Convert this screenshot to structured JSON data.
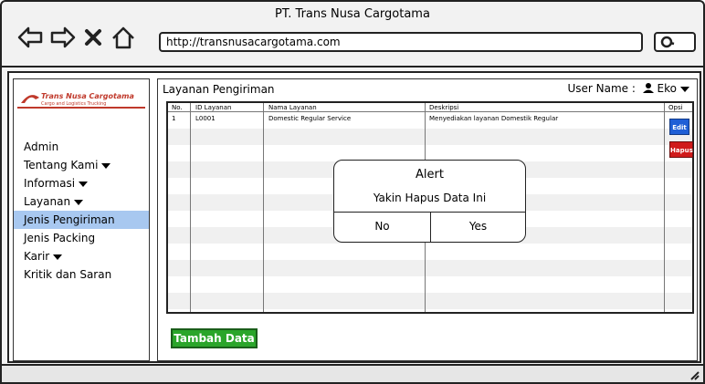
{
  "window": {
    "title": "PT. Trans Nusa Cargotama",
    "url": "http://transnusacargotama.com"
  },
  "sidebar": {
    "logo_text": "Trans Nusa Cargotama",
    "logo_sub": "Cargo and Logistics Trucking",
    "items": [
      {
        "label": "Admin",
        "has_caret": false
      },
      {
        "label": "Tentang Kami",
        "has_caret": true
      },
      {
        "label": "Informasi",
        "has_caret": true
      },
      {
        "label": "Layanan",
        "has_caret": true
      },
      {
        "label": "Jenis Pengiriman",
        "active": true
      },
      {
        "label": "Jenis Packing"
      },
      {
        "label": "Karir",
        "has_caret": true
      },
      {
        "label": "Kritik dan Saran"
      }
    ]
  },
  "main": {
    "heading": "Layanan Pengiriman",
    "user_label": "User Name :",
    "user_name": "Eko"
  },
  "table": {
    "columns": [
      "No.",
      "ID Layanan",
      "Nama Layanan",
      "Deskripsi",
      "Opsi"
    ],
    "rows": [
      {
        "no": "1",
        "id": "L0001",
        "nama": "Domestic Regular Service",
        "deskripsi": "Menyediakan layanan Domestik Regular"
      }
    ],
    "edit_label": "Edit",
    "hapus_label": "Hapus"
  },
  "actions": {
    "tambah_label": "Tambah Data"
  },
  "alert": {
    "title": "Alert",
    "message": "Yakin Hapus Data Ini",
    "no_label": "No",
    "yes_label": "Yes"
  },
  "colors": {
    "active_menu": "#a8c8f0",
    "edit_button": "#1f5fd6",
    "hapus_button": "#d01b1b",
    "tambah_button": "#2aa52a"
  },
  "icons": {
    "back": "back-arrow-icon",
    "forward": "forward-arrow-icon",
    "close": "close-icon",
    "home": "home-icon",
    "search": "search-icon",
    "user": "user-icon",
    "resize": "resize-grip-icon"
  }
}
